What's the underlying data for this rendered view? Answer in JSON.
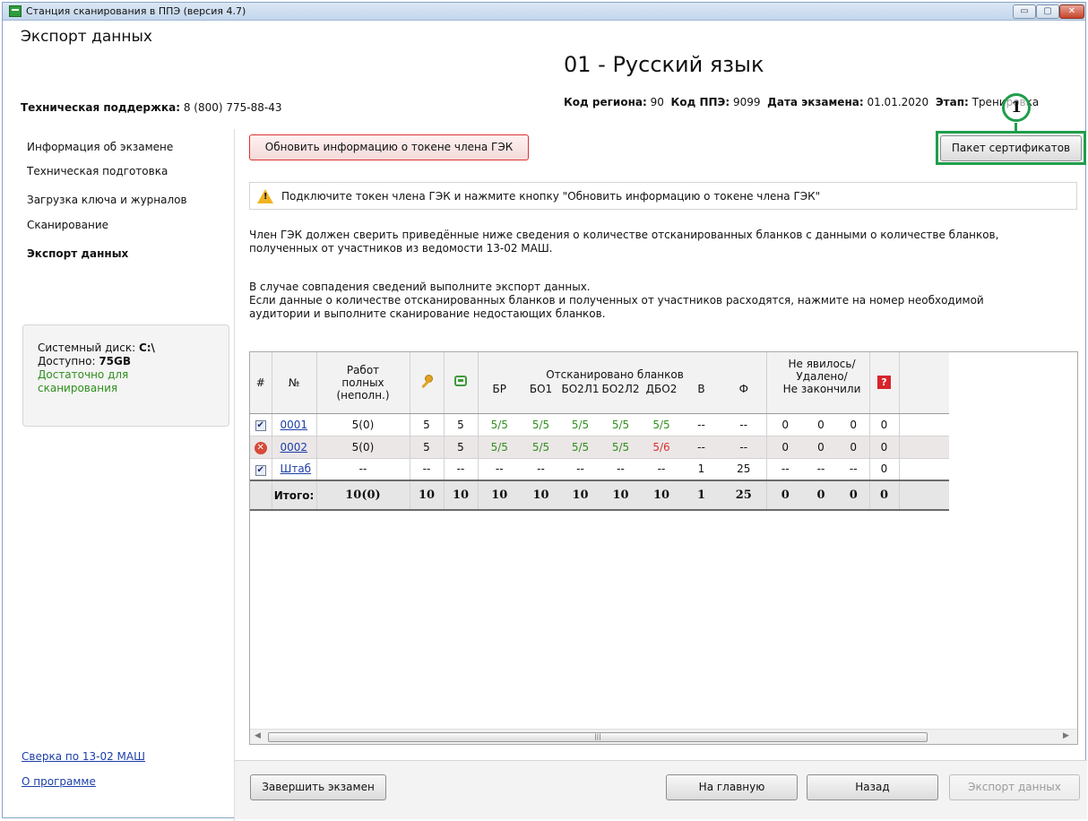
{
  "window": {
    "title": "Станция сканирования в ППЭ (версия 4.7)",
    "controls": {
      "minimize": "▭",
      "maximize": "▢",
      "close": "✕"
    }
  },
  "header": {
    "page_title": "Экспорт данных",
    "support_label": "Техническая поддержка:",
    "support_phone": "8 (800) 775-88-43",
    "exam_title": "01 - Русский язык",
    "region_label": "Код региона:",
    "region_value": "90",
    "ppe_label": "Код ППЭ:",
    "ppe_value": "9099",
    "date_label": "Дата экзамена:",
    "date_value": "01.01.2020",
    "stage_label": "Этап:",
    "stage_value": "Тренировка"
  },
  "sidebar": {
    "items": [
      {
        "label": "Информация об экзамене"
      },
      {
        "label": "Техническая подготовка"
      },
      {
        "label": "Загрузка ключа и журналов"
      },
      {
        "label": "Сканирование"
      },
      {
        "label": "Экспорт данных",
        "active": true
      }
    ],
    "disk": {
      "label": "Системный диск:",
      "value": "C:\\",
      "free_label": "Доступно:",
      "free_value": "75GB",
      "status_line1": "Достаточно для",
      "status_line2": "сканирования"
    },
    "links": [
      "Сверка по 13-02 МАШ",
      "О программе"
    ]
  },
  "actions": {
    "refresh_token": "Обновить информацию о токене члена ГЭК",
    "cert_package": "Пакет сертификатов",
    "marker": "1"
  },
  "warning": "Подключите токен члена ГЭК и нажмите кнопку \"Обновить информацию о токене члена ГЭК\"",
  "text": {
    "para1_line1": "Член ГЭК должен сверить приведённые ниже сведения о количестве отсканированных бланков с данными о количестве бланков,",
    "para1_line2": "полученных от участников из ведомости 13-02 МАШ.",
    "para2_line1": "В случае совпадения сведений выполните экспорт данных.",
    "para2_line2": "Если данные о количестве отсканированных бланков и полученных от участников расходятся, нажмите на номер необходимой",
    "para2_line3": "аудитории и выполните сканирование недостающих бланков."
  },
  "table": {
    "headers": {
      "hash": "#",
      "num": "№",
      "works_l1": "Работ",
      "works_l2": "полных",
      "works_l3": "(неполн.)",
      "scanned_title": "Отсканировано бланков",
      "br": "БР",
      "bo1": "БО1",
      "bo2l1": "БО2Л1",
      "bo2l2": "БО2Л2",
      "dbo2": "ДБО2",
      "v": "В",
      "f": "Ф",
      "absent_l1": "Не явилось/",
      "absent_l2": "Удалено/",
      "absent_l3": "Не закончили",
      "help": "?"
    },
    "rows": [
      {
        "status": "checked",
        "num": "0001",
        "works": "5(0)",
        "key": "5",
        "scan": "5",
        "br": "5/5",
        "bo1": "5/5",
        "bo2l1": "5/5",
        "bo2l2": "5/5",
        "dbo2": "5/5",
        "v": "--",
        "f": "--",
        "a1": "0",
        "a2": "0",
        "a3": "0",
        "last": "0"
      },
      {
        "status": "error",
        "num": "0002",
        "works": "5(0)",
        "key": "5",
        "scan": "5",
        "br": "5/5",
        "bo1": "5/5",
        "bo2l1": "5/5",
        "bo2l2": "5/5",
        "dbo2": "5/6",
        "v": "--",
        "f": "--",
        "a1": "0",
        "a2": "0",
        "a3": "0",
        "last": "0"
      },
      {
        "status": "checked",
        "num": "Штаб",
        "works": "--",
        "key": "--",
        "scan": "--",
        "br": "--",
        "bo1": "--",
        "bo2l1": "--",
        "bo2l2": "--",
        "dbo2": "--",
        "v": "1",
        "f": "25",
        "a1": "--",
        "a2": "--",
        "a3": "--",
        "last": "0"
      }
    ],
    "total": {
      "label": "Итого:",
      "works": "10(0)",
      "key": "10",
      "scan": "10",
      "br": "10",
      "bo1": "10",
      "bo2l1": "10",
      "bo2l2": "10",
      "dbo2": "10",
      "v": "1",
      "f": "25",
      "a1": "0",
      "a2": "0",
      "a3": "0",
      "last": "0"
    }
  },
  "footer": {
    "finish": "Завершить экзамен",
    "home": "На главную",
    "back": "Назад",
    "export": "Экспорт данных"
  },
  "colors": {
    "ok_green": "#2f8f1e",
    "error_red": "#d93030",
    "highlight_green": "#1f9e4b",
    "link_blue": "#1c3fa8"
  }
}
